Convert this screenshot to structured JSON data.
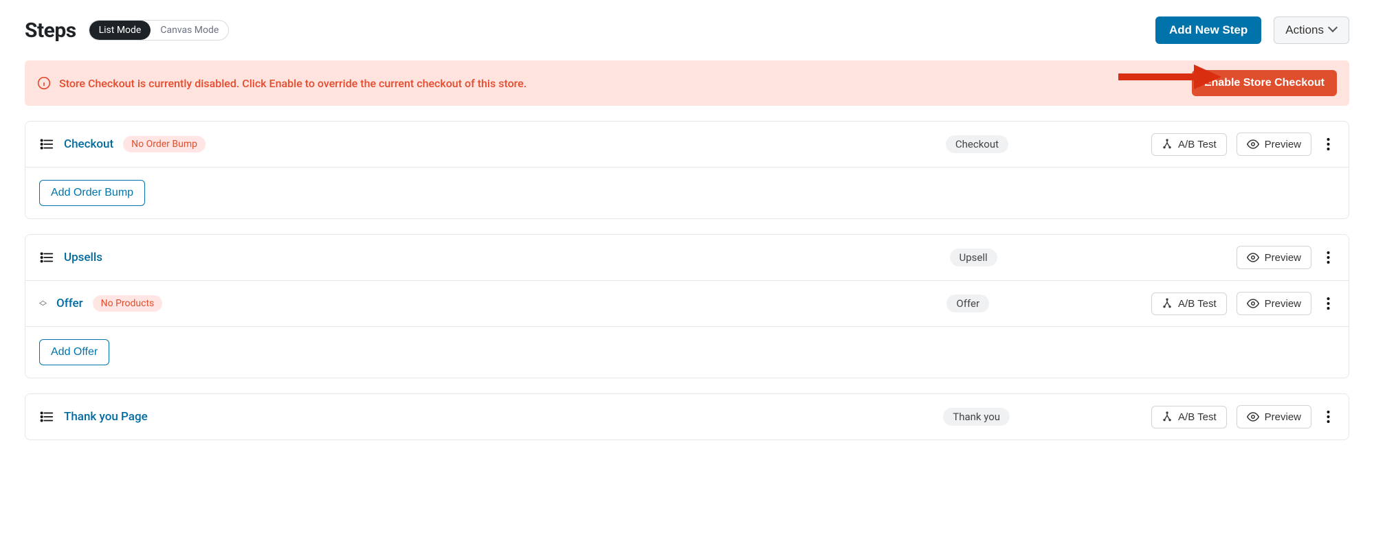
{
  "header": {
    "title": "Steps",
    "mode_list": "List Mode",
    "mode_canvas": "Canvas Mode",
    "add_new_step": "Add New Step",
    "actions": "Actions"
  },
  "alert": {
    "message": "Store Checkout is currently disabled. Click Enable to override the current checkout of this store.",
    "enable_button": "Enable Store Checkout"
  },
  "common": {
    "ab_test": "A/B Test",
    "preview": "Preview"
  },
  "cards": {
    "checkout": {
      "link": "Checkout",
      "badge": "No Order Bump",
      "tag": "Checkout",
      "add_button": "Add Order Bump"
    },
    "upsells": {
      "link": "Upsells",
      "tag": "Upsell",
      "offer_link": "Offer",
      "offer_badge": "No Products",
      "offer_tag": "Offer",
      "add_button": "Add Offer"
    },
    "thankyou": {
      "link": "Thank you Page",
      "tag": "Thank you"
    }
  }
}
